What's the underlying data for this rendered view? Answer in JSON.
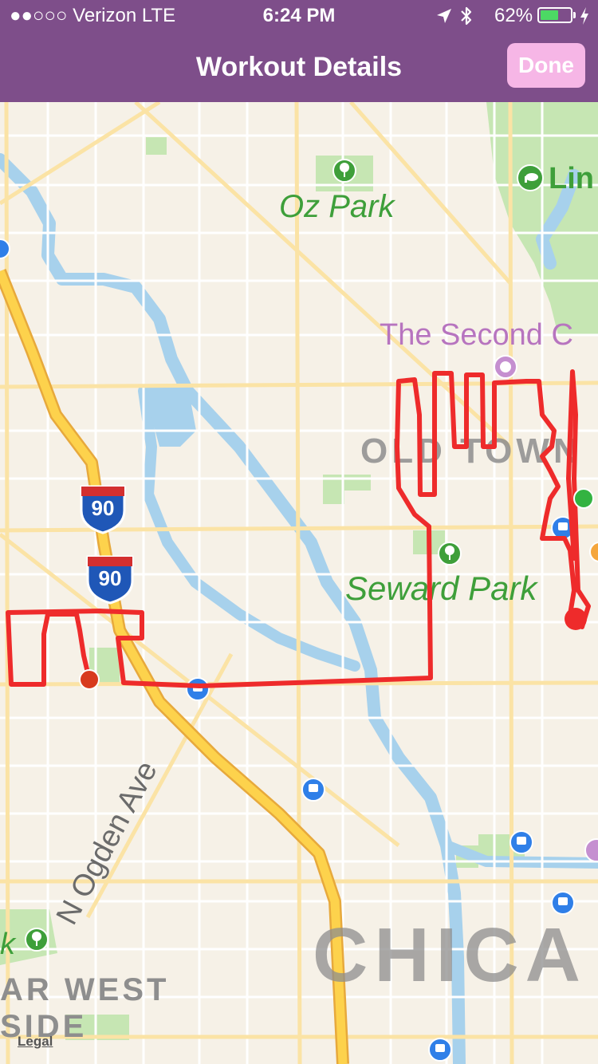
{
  "status_bar": {
    "carrier": "●●○○○ Verizon  LTE",
    "time": "6:24 PM",
    "battery_percent": "62%",
    "battery_level": 0.62,
    "icons": [
      "location-arrow-icon",
      "bluetooth-icon",
      "battery-icon",
      "charging-bolt-icon"
    ]
  },
  "nav": {
    "title": "Workout Details",
    "done_label": "Done"
  },
  "map": {
    "labels": {
      "oz_park": "Oz Park",
      "lincoln_park": "Lin",
      "second_city": "The Second C",
      "old_town": "OLD TOWN",
      "seward_park": "Seward Park",
      "ogden_ave": "N Ogden Ave",
      "park_left": "k",
      "far_west": "AR WEST",
      "side": "SIDE",
      "chicago": "CHICA",
      "interstate_top": "90",
      "interstate_bottom": "90"
    },
    "route_color": "#ee2b2b",
    "start_color": "#33b341",
    "end_color": "#d83a1e",
    "park_color": "#c6e6b3",
    "water_color": "#a7d1ec",
    "highway_color": "#fdd24c"
  },
  "legal_label": "Legal"
}
